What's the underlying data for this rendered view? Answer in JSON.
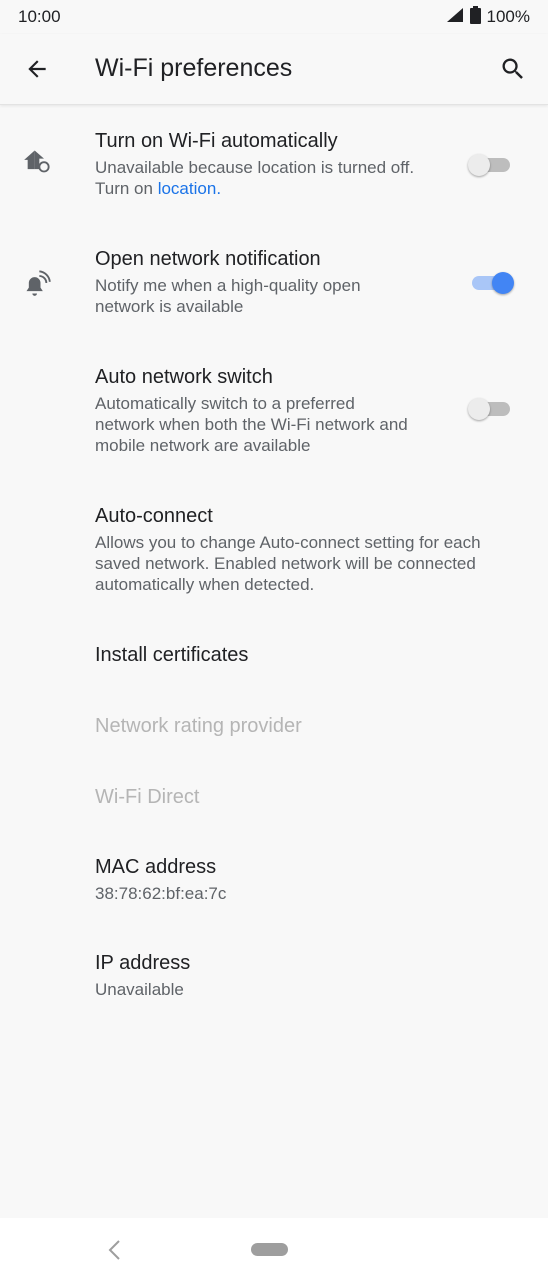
{
  "status": {
    "time": "10:00",
    "battery": "100%"
  },
  "header": {
    "title": "Wi-Fi preferences"
  },
  "items": [
    {
      "title": "Turn on Wi-Fi automatically",
      "subtitle_1": "Unavailable because location is turned off.",
      "subtitle_2": "Turn on",
      "link": "location",
      "suffix": ".",
      "toggle": "off",
      "icon": "home-sync-icon"
    },
    {
      "title": "Open network notification",
      "subtitle_1": "Notify me when a high-quality open",
      "subtitle_2": "network is available",
      "toggle": "on",
      "icon": "wifi-bell-icon"
    },
    {
      "title": "Auto network switch",
      "subtitle_1": "Automatically switch to a preferred",
      "subtitle_2": "network when both the Wi-Fi network and",
      "subtitle_3": "mobile network are available",
      "toggle": "off"
    },
    {
      "title": "Auto-connect",
      "subtitle_1": "Allows you to change Auto-connect setting for each",
      "subtitle_2": "saved network. Enabled network will be connected",
      "subtitle_3": "automatically when detected."
    },
    {
      "title": "Install certificates"
    },
    {
      "title": "Network rating provider",
      "disabled": true
    },
    {
      "title": "Wi-Fi Direct",
      "disabled": true
    },
    {
      "title": "MAC address",
      "subtitle_1": "38:78:62:bf:ea:7c"
    },
    {
      "title": "IP address",
      "subtitle_1": "Unavailable"
    }
  ],
  "colors": {
    "accent": "#4285f4",
    "link": "#1a73e8",
    "background": "#f8f8f8"
  }
}
